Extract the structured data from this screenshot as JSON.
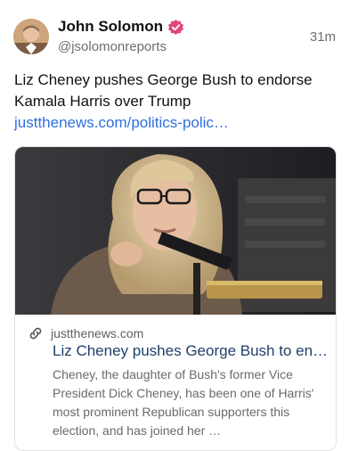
{
  "author": {
    "display_name": "John Solomon",
    "handle": "@jsolomonreports",
    "avatar_icon": "profile-photo",
    "verified_icon": "verified-badge-icon",
    "verified_color": "#e0457b"
  },
  "post": {
    "time": "31m",
    "text": "Liz Cheney pushes George Bush to endorse Kamala Harris over Trump ",
    "link_text": "justthenews.com/politics-polic…",
    "link_color": "#2f6fe0"
  },
  "card": {
    "image_icon": "article-photo",
    "link_icon": "link-icon",
    "domain": "justthenews.com",
    "title": "Liz Cheney pushes George Bush to en…",
    "description": "Cheney, the daughter of Bush's former Vice President Dick Cheney, has been one of Harris' most prominent Republican supporters this election, and has joined her …"
  }
}
